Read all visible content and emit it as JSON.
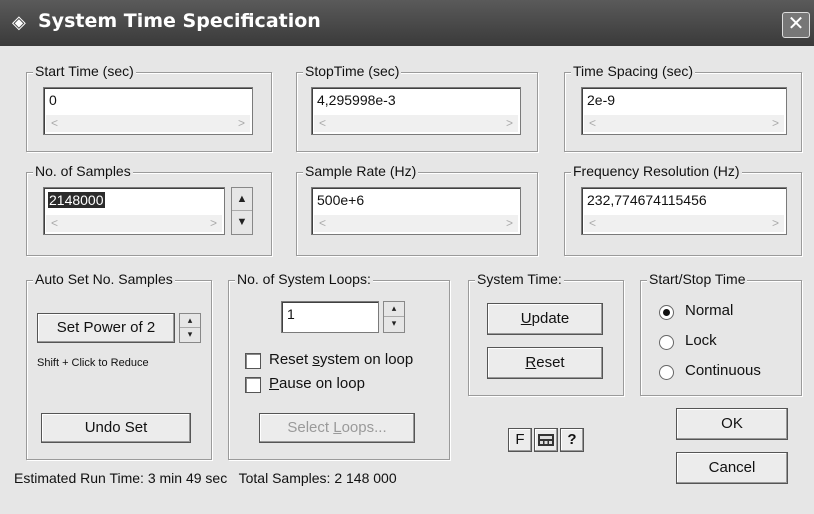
{
  "window": {
    "title": "System Time Specification",
    "close_glyph": "✕",
    "icon": "diamond-icon"
  },
  "time": {
    "start": {
      "label": "Start Time (sec)",
      "value": "0"
    },
    "stop": {
      "label": "StopTime (sec)",
      "value": "4,295998e-3"
    },
    "spacing": {
      "label": "Time Spacing (sec)",
      "value": "2e-9"
    }
  },
  "samples": {
    "num": {
      "label": "No. of Samples",
      "value": "2148000"
    },
    "rate": {
      "label": "Sample Rate (Hz)",
      "value": "500e+6"
    },
    "freq_res": {
      "label": "Frequency Resolution (Hz)",
      "value": "232,774674115456"
    }
  },
  "auto_set": {
    "label": "Auto Set No. Samples",
    "power_button": "Set Power of 2",
    "hint": "Shift + Click to Reduce",
    "undo_button": "Undo Set"
  },
  "loops": {
    "label": "No. of System Loops:",
    "value": "1",
    "reset_pre": "Reset ",
    "reset_u": "s",
    "reset_post": "ystem on loop",
    "pause_u": "P",
    "pause_post": "ause on loop",
    "select_pre": "Select ",
    "select_u": "L",
    "select_post": "oops...",
    "reset_checked": false,
    "pause_checked": false
  },
  "system_time": {
    "label": "System Time:",
    "update_u": "U",
    "update_post": "pdate",
    "reset_u": "R",
    "reset_post": "eset"
  },
  "start_stop": {
    "label": "Start/Stop Time",
    "options": [
      "Normal",
      "Lock",
      "Continuous"
    ],
    "selected": "Normal"
  },
  "tools": {
    "f": "F",
    "calc_icon": "calculator-icon",
    "help": "?"
  },
  "actions": {
    "ok": "OK",
    "cancel": "Cancel"
  },
  "status": {
    "run_time": "Estimated Run Time: 3 min 49 sec",
    "total": "Total Samples: 2 148 000"
  }
}
